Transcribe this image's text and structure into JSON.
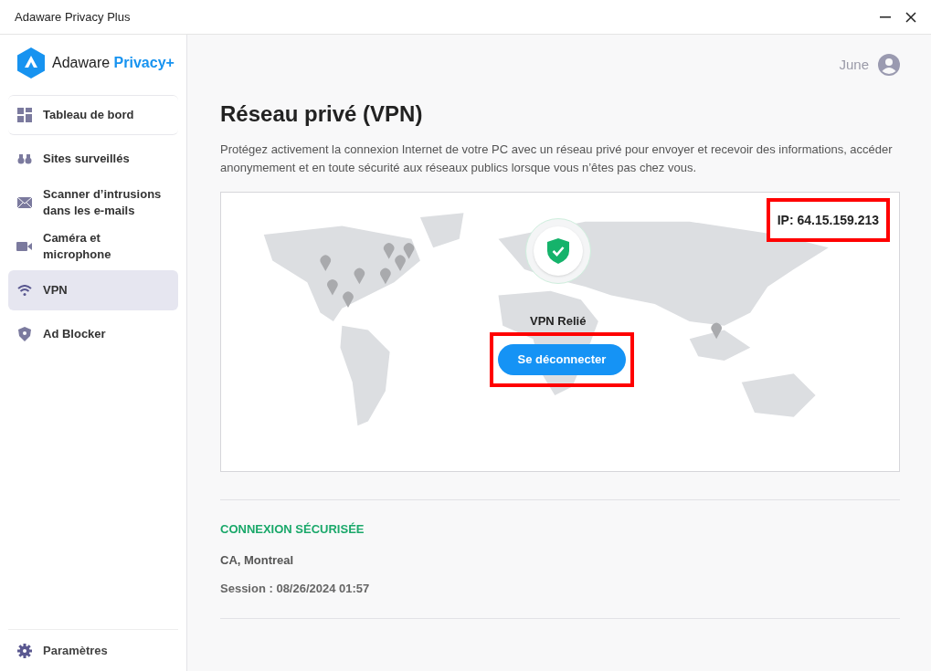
{
  "window": {
    "title": "Adaware Privacy Plus"
  },
  "sidebar": {
    "logo": {
      "name": "Adaware",
      "accent": "Privacy+"
    },
    "items": [
      {
        "kind": "dashboard",
        "label": "Tableau de bord",
        "selected": false
      },
      {
        "kind": "binoculars",
        "label": "Sites surveillés",
        "selected": false
      },
      {
        "kind": "mail",
        "label": "Scanner d’intrusions dans les e-mails",
        "selected": false
      },
      {
        "kind": "camera",
        "label": "Caméra et microphone",
        "selected": false
      },
      {
        "kind": "wifi",
        "label": "VPN",
        "selected": true
      },
      {
        "kind": "shield",
        "label": "Ad Blocker",
        "selected": false
      }
    ],
    "settings": "Paramètres"
  },
  "user": {
    "name": "June"
  },
  "page": {
    "title": "Réseau privé (VPN)",
    "description": "Protégez activement la connexion Internet de votre PC avec un réseau privé pour envoyer et recevoir des informations, accéder anonymement et en toute sécurité aux réseaux publics lorsque vous n’êtes pas chez vous."
  },
  "map": {
    "ip": {
      "text": "IP: 64.15.159.213",
      "highlighted": true
    },
    "status": "VPN Relié",
    "button": {
      "label": "Se déconnecter",
      "highlighted": true
    }
  },
  "connection": {
    "heading": "CONNEXION SÉCURISÉE",
    "location": "CA, Montreal",
    "session": "Session : 08/26/2024 01:57"
  }
}
